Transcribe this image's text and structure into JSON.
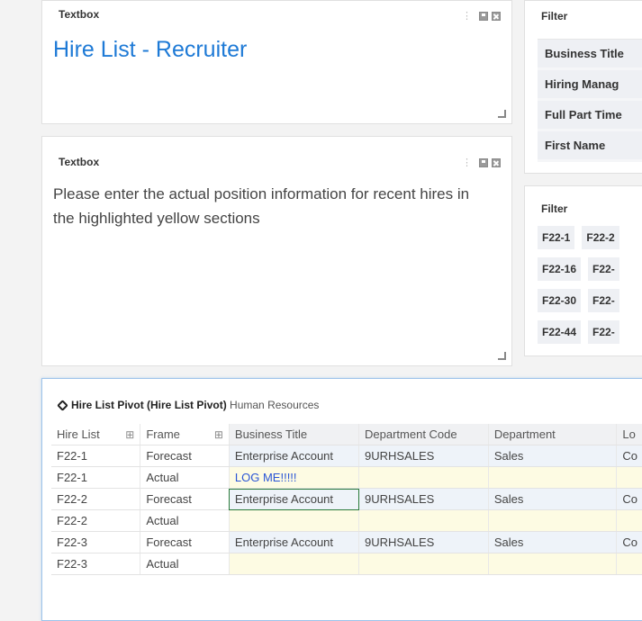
{
  "textbox1": {
    "header": "Textbox",
    "title": "Hire List - Recruiter"
  },
  "textbox2": {
    "header": "Textbox",
    "text": "Please enter the actual position information for recent hires in the highlighted yellow sections"
  },
  "filter1": {
    "header": "Filter",
    "items": [
      "Business Title",
      "Hiring Manag",
      "Full Part Time",
      "First Name"
    ]
  },
  "filter2": {
    "header": "Filter",
    "chips": [
      [
        "F22-1",
        "F22-2"
      ],
      [
        "F22-16",
        "F22-"
      ],
      [
        "F22-30",
        "F22-"
      ],
      [
        "F22-44",
        "F22-"
      ]
    ]
  },
  "pivot": {
    "title": "Hire List Pivot (Hire List Pivot)",
    "subtitle": "Human Resources",
    "columns": [
      "Hire List",
      "Frame",
      "Business Title",
      "Department Code",
      "Department",
      "Lo"
    ],
    "rows": [
      {
        "hire": "F22-1",
        "frame": "Forecast",
        "title": "Enterprise Account",
        "code": "9URHSALES",
        "dept": "Sales",
        "loc": "Co"
      },
      {
        "hire": "F22-1",
        "frame": "Actual",
        "title": "LOG ME!!!!!",
        "code": "",
        "dept": "",
        "loc": ""
      },
      {
        "hire": "F22-2",
        "frame": "Forecast",
        "title": "Enterprise Account",
        "code": "9URHSALES",
        "dept": "Sales",
        "loc": "Co"
      },
      {
        "hire": "F22-2",
        "frame": "Actual",
        "title": "",
        "code": "",
        "dept": "",
        "loc": ""
      },
      {
        "hire": "F22-3",
        "frame": "Forecast",
        "title": "Enterprise Account",
        "code": "9URHSALES",
        "dept": "Sales",
        "loc": "Co"
      },
      {
        "hire": "F22-3",
        "frame": "Actual",
        "title": "",
        "code": "",
        "dept": "",
        "loc": ""
      }
    ]
  },
  "colors": {
    "title_blue": "#1e7ad6",
    "actual_yellow": "#fdfbe3",
    "forecast_blue": "#eef3f9",
    "selection_green": "#2a7a3a"
  }
}
